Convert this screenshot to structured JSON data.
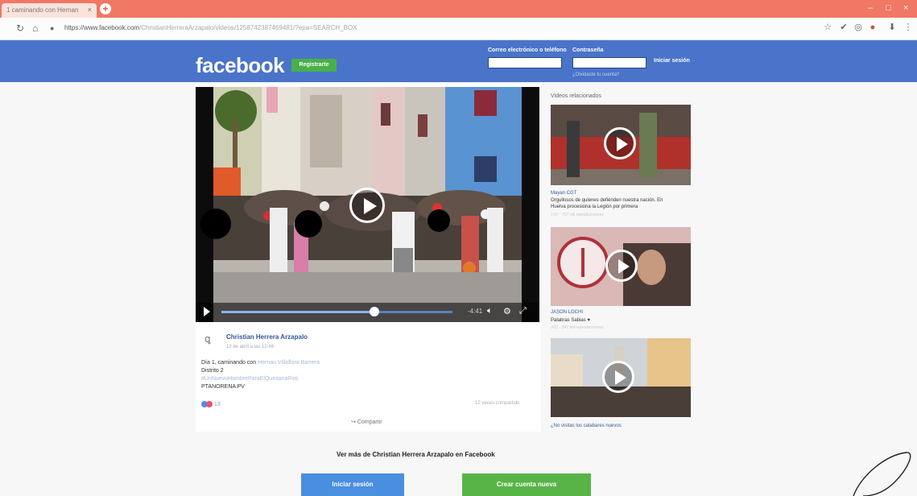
{
  "browser": {
    "tab_title": "1 caminando con Hernan",
    "tab_close": "×",
    "new_tab": "+",
    "url_main": "https://www.facebook.com",
    "url_rest": "/ChristianHerreraArzapalo/videos/1258742387469481/?epa=SEARCH_BOX",
    "win_minimize": "–",
    "win_maximize": "□",
    "win_close": "×"
  },
  "header": {
    "logo": "facebook",
    "register_label": "Registrarte",
    "email_label": "Correo electrónico o teléfono",
    "password_label": "Contraseña",
    "login_label": "Iniciar sesión",
    "forgot_label": "¿Olvidaste tu cuenta?"
  },
  "video": {
    "time": "-4:41"
  },
  "post": {
    "author": "Christian Herrera Arzapalo",
    "timestamp": "13 de abril a las 12:46 ·",
    "line1_prefix": "Día 1, caminando con",
    "line1_link": "Hernan Villaflora Barrera",
    "line2": "Distrito 2",
    "line3": "#UnNuevoHombreParaElQuintanaRoo",
    "line4": "PTANORENA PV",
    "reaction_count": "13",
    "shares": "12 veces compartido",
    "share_button": "Compartir"
  },
  "related": {
    "heading": "Videos relacionados",
    "items": [
      {
        "channel": "Mayan CGT",
        "title_l1": "Orgullosos de quienes defienden nuestra nación. En",
        "title_l2": "Huelva procesiona la Legión por primera",
        "meta": "1:57 · 797 mil reproducciones"
      },
      {
        "channel": "JASON LOCHI",
        "title_l1": "Palabras Sabias ♥",
        "title_l2": "",
        "meta": "3:11 · 347 mil reproducciones"
      },
      {
        "channel": "",
        "title_l1": "¿No visitas los calabares nuevos",
        "title_l2": "",
        "meta": ""
      }
    ]
  },
  "cta": {
    "text": "Ver más de Christian Herrera Arzapalo en Facebook",
    "login": "Iniciar sesión",
    "create": "Crear cuenta nueva"
  },
  "colors": {
    "fb_blue": "#4a74c9",
    "tab_bar": "#f07864",
    "green": "#58b446",
    "login_blue": "#4a8ee0"
  }
}
